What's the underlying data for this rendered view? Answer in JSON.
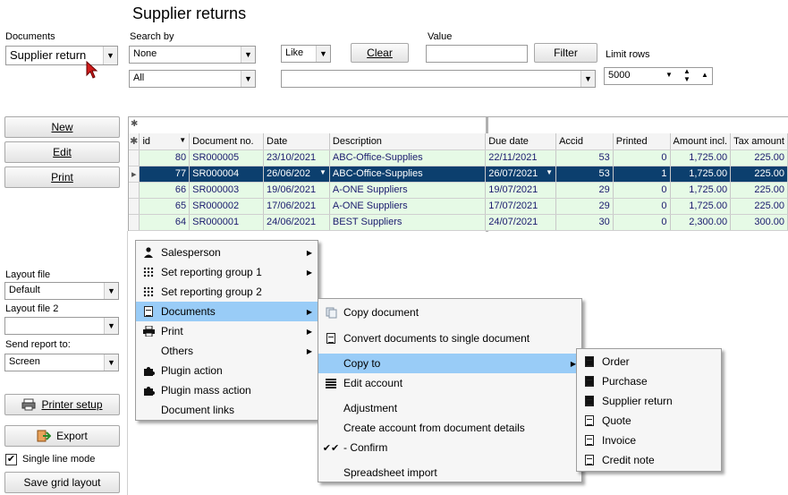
{
  "page": {
    "title": "Supplier returns"
  },
  "documents": {
    "label": "Documents",
    "value": "Supplier return"
  },
  "search": {
    "label": "Search by",
    "field_value": "None",
    "scope_value": "All"
  },
  "operator": {
    "value": "Like"
  },
  "value_field": {
    "label": "Value",
    "text": ""
  },
  "buttons": {
    "clear": "Clear",
    "filter": "Filter",
    "new": "New",
    "edit": "Edit",
    "print": "Print",
    "printer_setup": "Printer setup",
    "export": "Export",
    "save_grid": "Save grid layout"
  },
  "limit": {
    "label": "Limit rows",
    "value": "5000"
  },
  "layout": {
    "label1": "Layout file",
    "value1": "Default",
    "label2": "Layout file 2",
    "value2": "",
    "send_label": "Send report to:",
    "send_value": "Screen"
  },
  "single_line": {
    "label": "Single line mode",
    "checked": true
  },
  "grid": {
    "columns": [
      "id",
      "Document no.",
      "Date",
      "Description",
      "Due date",
      "Accid",
      "Printed",
      "Amount incl.",
      "Tax amount"
    ],
    "rows": [
      [
        "80",
        "SR000005",
        "23/10/2021",
        "ABC-Office-Supplies",
        "22/11/2021",
        "53",
        "0",
        "1,725.00",
        "225.00"
      ],
      [
        "77",
        "SR000004",
        "26/06/202",
        "ABC-Office-Supplies",
        "26/07/2021",
        "53",
        "1",
        "1,725.00",
        "225.00"
      ],
      [
        "66",
        "SR000003",
        "19/06/2021",
        "A-ONE Suppliers",
        "19/07/2021",
        "29",
        "0",
        "1,725.00",
        "225.00"
      ],
      [
        "65",
        "SR000002",
        "17/06/2021",
        "A-ONE Suppliers",
        "17/07/2021",
        "29",
        "0",
        "1,725.00",
        "225.00"
      ],
      [
        "64",
        "SR000001",
        "24/06/2021",
        "BEST Suppliers",
        "24/07/2021",
        "30",
        "0",
        "2,300.00",
        "300.00"
      ]
    ]
  },
  "context_menu": [
    "Salesperson",
    "Set reporting group 1",
    "Set reporting group 2",
    "Documents",
    "Print",
    "Others",
    "Plugin action",
    "Plugin mass action",
    "Document links"
  ],
  "documents_menu": [
    "Copy document",
    "Convert documents to single document",
    "Copy to",
    "Edit account",
    "Adjustment",
    "Create account from document details",
    "- Confirm",
    "Spreadsheet import"
  ],
  "copy_to_menu": [
    "Order",
    "Purchase",
    "Supplier return",
    "Quote",
    "Invoice",
    "Credit note"
  ],
  "colors": {
    "selected_row": "#0c3f6e",
    "row_bg": "#e6fae6",
    "menu_highlight": "#99ccf7"
  }
}
